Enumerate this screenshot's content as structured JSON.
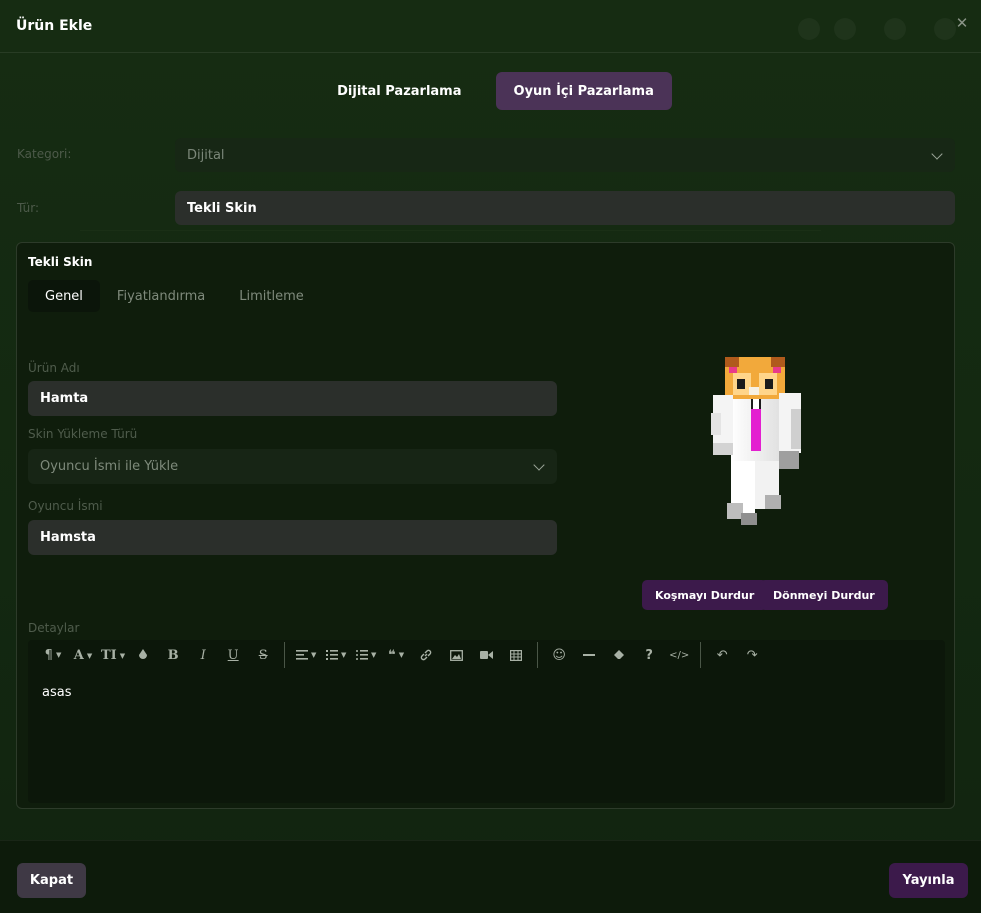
{
  "modal": {
    "title": "Ürün Ekle"
  },
  "top_tabs": [
    {
      "label": "Dijital Pazarlama",
      "active": false
    },
    {
      "label": "Oyun İçi Pazarlama",
      "active": true
    }
  ],
  "kategori": {
    "label": "Kategori:",
    "value": "Dijital"
  },
  "tur": {
    "label": "Tür:",
    "value": "Tekli Skin"
  },
  "panel": {
    "title": "Tekli Skin",
    "tabs": [
      {
        "label": "Genel",
        "active": true
      },
      {
        "label": "Fiyatlandırma",
        "active": false
      },
      {
        "label": "Limitleme",
        "active": false
      }
    ]
  },
  "form": {
    "urun_adi": {
      "label": "Ürün Adı",
      "value": "Hamta"
    },
    "skin_yukleme": {
      "label": "Skin Yükleme Türü",
      "value": "Oyuncu İsmi ile Yükle"
    },
    "oyuncu_ismi": {
      "label": "Oyuncu İsmi",
      "value": "Hamsta"
    }
  },
  "skin_buttons": {
    "stop_run": "Koşmayı Durdur",
    "stop_rotate": "Dönmeyi Durdur"
  },
  "details": {
    "label": "Detaylar",
    "content": "asas",
    "toolbar": [
      "paragraph-icon",
      "font-color-icon",
      "font-size-icon",
      "color-drop-icon",
      "bold-icon",
      "italic-icon",
      "underline-icon",
      "strikethrough-icon",
      "align-icon",
      "ordered-list-icon",
      "unordered-list-icon",
      "quote-icon",
      "link-icon",
      "image-icon",
      "video-icon",
      "table-icon",
      "emoji-icon",
      "horizontal-rule-icon",
      "eraser-icon",
      "help-icon",
      "code-view-icon",
      "undo-icon",
      "redo-icon"
    ]
  },
  "footer": {
    "close_label": "Kapat",
    "publish_label": "Yayınla"
  },
  "colors": {
    "accent": "#3c1a4b",
    "tab_active": "#4b3357",
    "background": "#132811"
  }
}
